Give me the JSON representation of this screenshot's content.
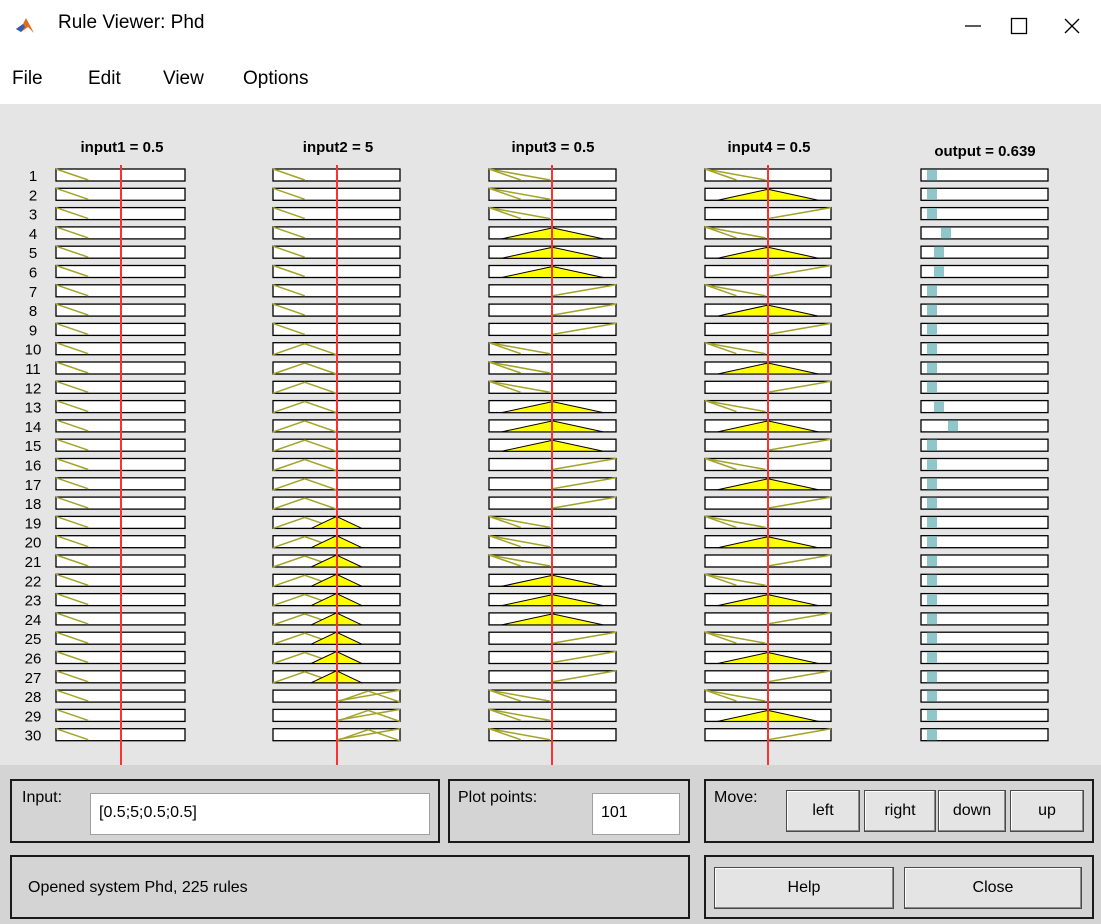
{
  "window": {
    "title": "Rule Viewer: Phd",
    "minimize_icon": "minimize-icon",
    "maximize_icon": "maximize-icon",
    "close_icon": "close-icon"
  },
  "menu": {
    "items": [
      "File",
      "Edit",
      "View",
      "Options"
    ]
  },
  "plots": {
    "headers": [
      "input1 = 0.5",
      "input2 = 5",
      "input3 = 0.5",
      "input4 = 0.5",
      "output = 0.639"
    ],
    "rule_numbers": [
      "1",
      "2",
      "3",
      "4",
      "5",
      "6",
      "7",
      "8",
      "9",
      "10",
      "11",
      "12",
      "13",
      "14",
      "15",
      "16",
      "17",
      "18",
      "19",
      "20",
      "21",
      "22",
      "23",
      "24",
      "25",
      "26",
      "27",
      "28",
      "29",
      "30"
    ],
    "input1_mf": [
      "L",
      "L",
      "L",
      "L",
      "L",
      "L",
      "L",
      "L",
      "L",
      "L",
      "L",
      "L",
      "L",
      "L",
      "L",
      "L",
      "L",
      "L",
      "L",
      "L",
      "L",
      "L",
      "L",
      "L",
      "L",
      "L",
      "L",
      "L",
      "L",
      "L"
    ],
    "input2_mf": [
      "L",
      "L",
      "L",
      "L",
      "L",
      "L",
      "L",
      "L",
      "L",
      "M",
      "M",
      "M",
      "M",
      "M",
      "M",
      "M",
      "M",
      "M",
      "M",
      "M",
      "M",
      "M",
      "M",
      "M",
      "M",
      "M",
      "M",
      "H",
      "H",
      "H"
    ],
    "input3_mf": [
      "L",
      "L",
      "L",
      "M",
      "M",
      "M",
      "H",
      "H",
      "H",
      "L",
      "L",
      "L",
      "M",
      "M",
      "M",
      "H",
      "H",
      "H",
      "L",
      "L",
      "L",
      "M",
      "M",
      "M",
      "H",
      "H",
      "H",
      "L",
      "L",
      "L"
    ],
    "input4_mf": [
      "L",
      "M",
      "H",
      "L",
      "M",
      "H",
      "L",
      "M",
      "H",
      "L",
      "M",
      "H",
      "L",
      "M",
      "H",
      "L",
      "M",
      "H",
      "L",
      "M",
      "H",
      "L",
      "M",
      "H",
      "L",
      "M",
      "H",
      "L",
      "M",
      "H"
    ],
    "output_mf": [
      1,
      1,
      1,
      3,
      2,
      2,
      1,
      1,
      1,
      1,
      1,
      1,
      2,
      4,
      1,
      1,
      1,
      1,
      1,
      1,
      1,
      1,
      1,
      1,
      1,
      1,
      1,
      1,
      1,
      1
    ],
    "colors": {
      "fill": "#ffff00",
      "fill_edge": "#000000",
      "mf_line": "#a3a32a",
      "index_line": "#ff3030",
      "output": "#8fc6c9"
    }
  },
  "controls": {
    "input_label": "Input:",
    "input_value": "[0.5;5;0.5;0.5]",
    "plot_points_label": "Plot points:",
    "plot_points_value": "101",
    "move_label": "Move:",
    "move_buttons": [
      "left",
      "right",
      "down",
      "up"
    ],
    "status_text": "Opened system Phd, 225 rules",
    "help_label": "Help",
    "close_label": "Close"
  }
}
